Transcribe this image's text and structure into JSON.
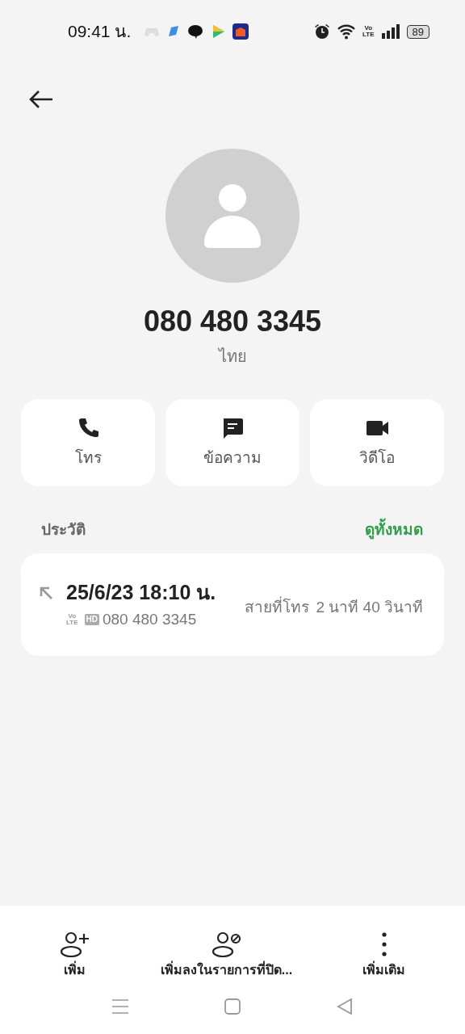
{
  "status_bar": {
    "time": "09:41 น.",
    "network_label_top": "Vo",
    "network_label_bottom": "LTE",
    "battery": "89"
  },
  "contact": {
    "number": "080 480 3345",
    "region": "ไทย"
  },
  "actions": [
    {
      "kind": "call",
      "label": "โทร"
    },
    {
      "kind": "message",
      "label": "ข้อความ"
    },
    {
      "kind": "video",
      "label": "วิดีโอ"
    }
  ],
  "history": {
    "title": "ประวัติ",
    "see_all": "ดูทั้งหมด",
    "entries": [
      {
        "datetime": "25/6/23 18:10 น.",
        "volte_top": "Vo",
        "volte_bottom": "LTE",
        "hd": "HD",
        "number": "080 480 3345",
        "type": "สายที่โทร",
        "duration": "2 นาที 40 วินาที"
      }
    ]
  },
  "bottom_actions": [
    {
      "kind": "add",
      "label": "เพิ่ม"
    },
    {
      "kind": "block",
      "label": "เพิ่มลงในรายการที่ปิด..."
    },
    {
      "kind": "more",
      "label": "เพิ่มเติม"
    }
  ]
}
